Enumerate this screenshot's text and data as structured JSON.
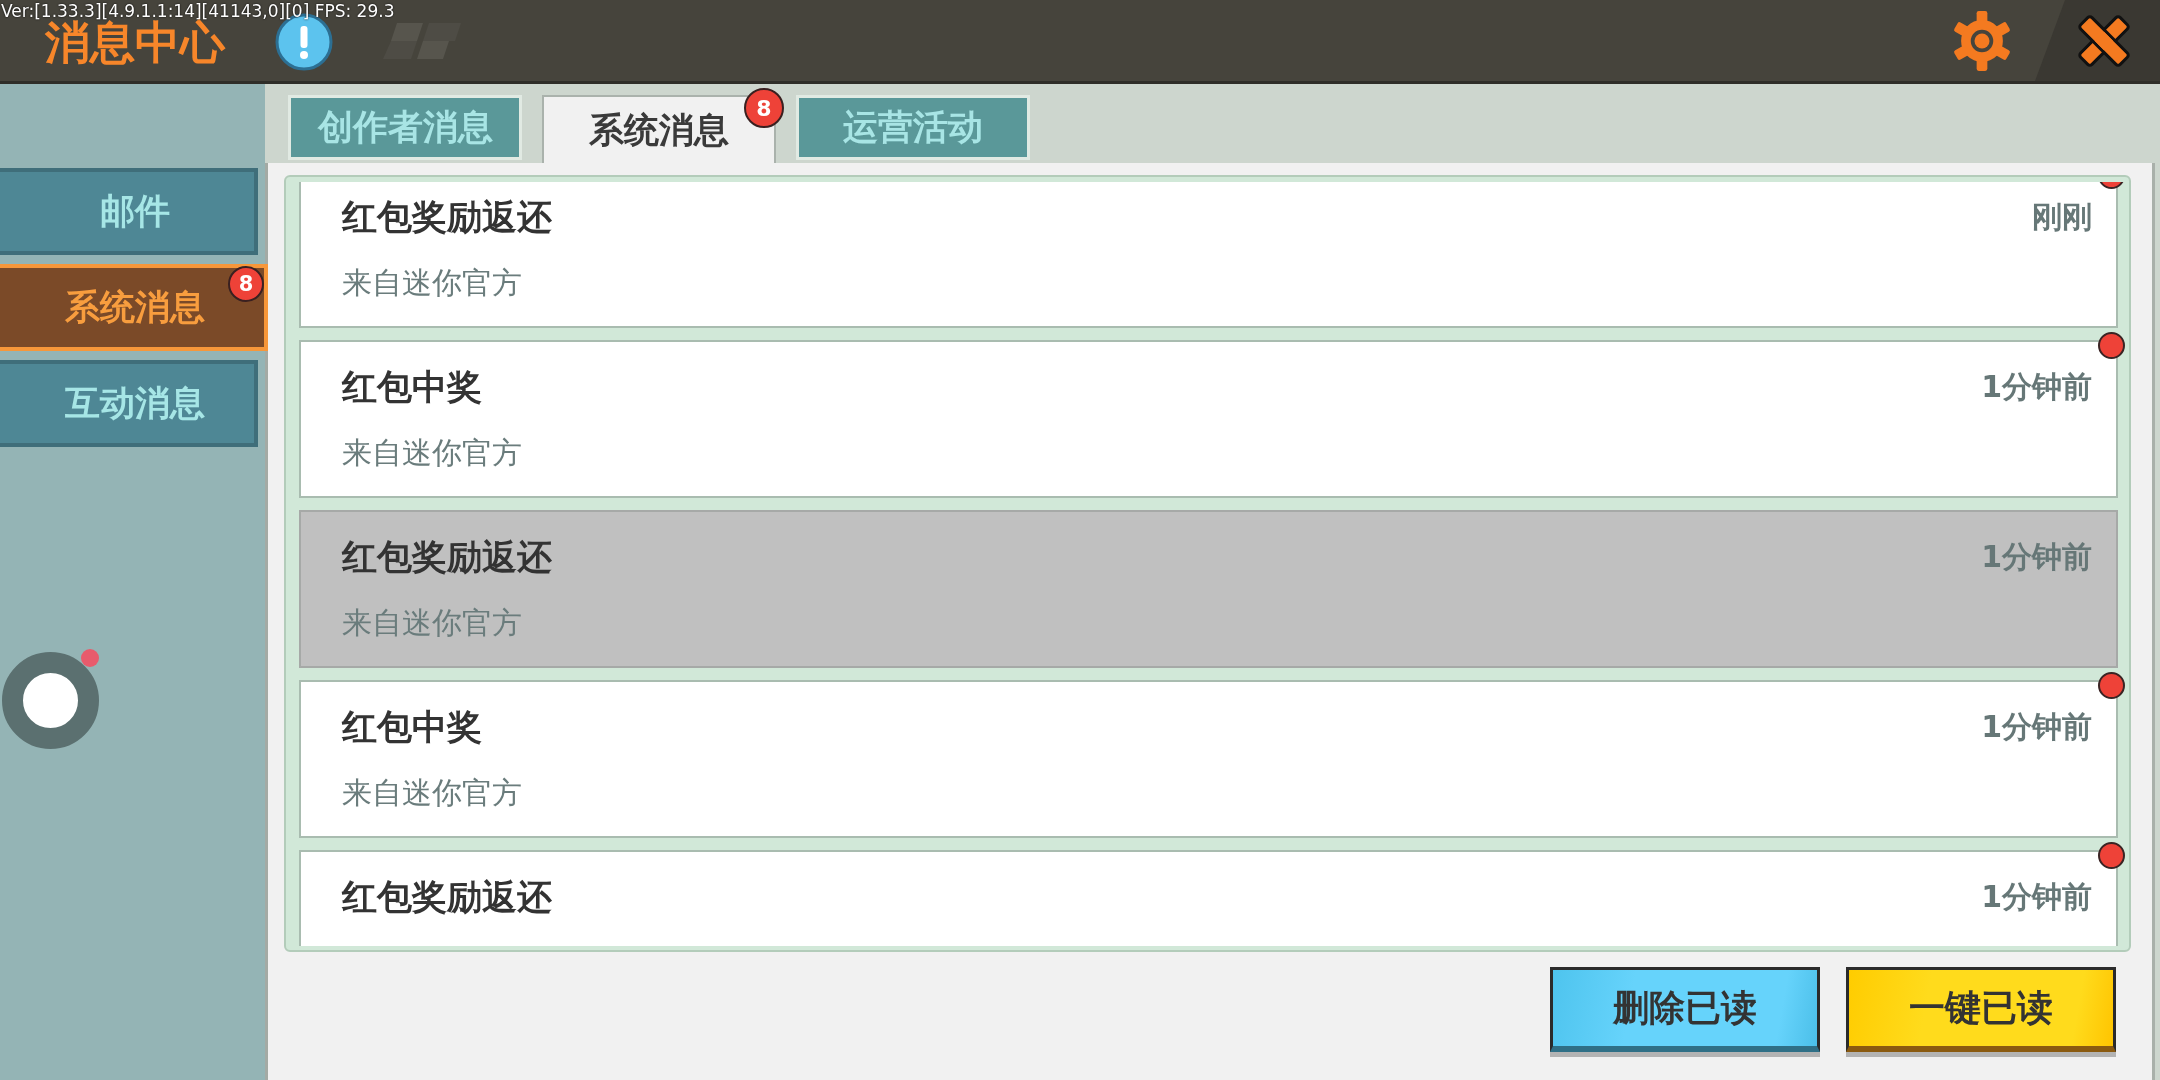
{
  "debug_overlay": {
    "text": "Ver:[1.33.3][4.9.1.1:14][41143,0][0] FPS: 29.3"
  },
  "header": {
    "title": "消息中心"
  },
  "sidebar": {
    "items": [
      {
        "label": "邮件",
        "selected": false
      },
      {
        "label": "系统消息",
        "selected": true,
        "badge": "8"
      },
      {
        "label": "互动消息",
        "selected": false
      }
    ],
    "floating_button": {
      "notification": true
    }
  },
  "tabs": [
    {
      "label": "创作者消息",
      "selected": false
    },
    {
      "label": "系统消息",
      "selected": true,
      "badge": "8"
    },
    {
      "label": "运营活动",
      "selected": false
    }
  ],
  "messages": [
    {
      "title": "红包奖励返还",
      "sender": "来自迷你官方",
      "time": "刚刚",
      "unread": true
    },
    {
      "title": "红包中奖",
      "sender": "来自迷你官方",
      "time": "1分钟前",
      "unread": true
    },
    {
      "title": "红包奖励返还",
      "sender": "来自迷你官方",
      "time": "1分钟前",
      "unread": false
    },
    {
      "title": "红包中奖",
      "sender": "来自迷你官方",
      "time": "1分钟前",
      "unread": true
    },
    {
      "title": "红包奖励返还",
      "time": "1分钟前",
      "unread": true
    }
  ],
  "buttons": [
    {
      "label": "删除已读",
      "kind": "secondary"
    },
    {
      "label": "一键已读",
      "kind": "primary"
    }
  ]
}
